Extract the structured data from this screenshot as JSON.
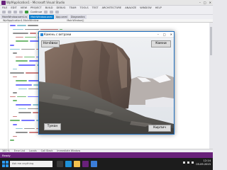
{
  "ide": {
    "title": "WpfApplication1 - Microsoft Visual Studio",
    "menu": [
      "FILE",
      "EDIT",
      "VIEW",
      "PROJECT",
      "BUILD",
      "DEBUG",
      "TEAM",
      "TOOLS",
      "TEST",
      "ARCHITECTURE",
      "ANALYZE",
      "WINDOW",
      "HELP"
    ],
    "toolbar_start_label": "Continue",
    "tabs": [
      "MainWindow.xaml.cs",
      "MainWindow.xaml",
      "App.xaml",
      "Diagnostics"
    ],
    "nav_left": "WpfApplication1.MainWindow",
    "nav_right": "MainWindow()",
    "zoom": "100 %",
    "bottom_tabs": [
      "Error List",
      "Locals",
      "Call Stack",
      "Immediate Window"
    ],
    "status": "Ready",
    "colors": {
      "status_bar": "#68217a",
      "active_tab": "#007acc",
      "keyword": "#0000ff",
      "string": "#a31515",
      "comment": "#008000"
    }
  },
  "app": {
    "window_title": "Камень с ветрами",
    "buttons": {
      "top_left": "Ночёвки",
      "top_right": "Камни",
      "bottom_left": "Туман",
      "bottom_right": "Кирпич"
    }
  },
  "taskbar": {
    "search_placeholder": "Ask me anything",
    "time": "12:14",
    "date": "05.09.2015"
  }
}
